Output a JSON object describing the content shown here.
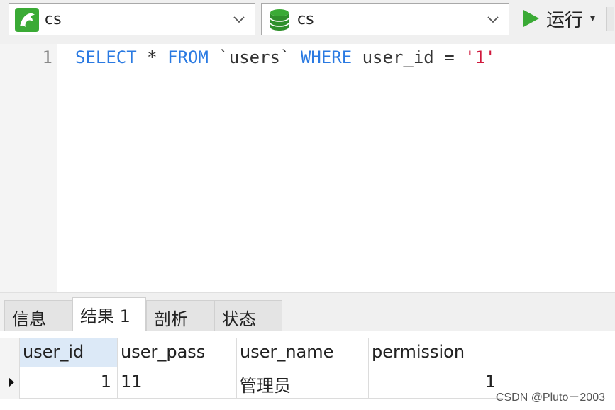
{
  "toolbar": {
    "connection": {
      "label": "cs",
      "icon": "mysql-dolphin-icon"
    },
    "database": {
      "label": "cs",
      "icon": "database-icon"
    },
    "run_label": "运行",
    "run_caret": "▾"
  },
  "editor": {
    "line_number": "1",
    "tokens": {
      "select": "SELECT",
      "star": " * ",
      "from": "FROM",
      "table": " `users` ",
      "where": "WHERE",
      "cond": " user_id = ",
      "value": "'1'"
    }
  },
  "tabs": [
    {
      "label": "信息"
    },
    {
      "label": "结果 1"
    },
    {
      "label": "剖析"
    },
    {
      "label": "状态"
    }
  ],
  "active_tab": "结果 1",
  "result": {
    "columns": [
      "user_id",
      "user_pass",
      "user_name",
      "permission"
    ],
    "rows": [
      [
        "1",
        "11",
        "管理员",
        "1"
      ]
    ]
  },
  "watermark": "CSDN @Pluto－2003",
  "colors": {
    "keyword": "#2a7ae2",
    "string": "#d0183c",
    "run_green": "#3aaa35",
    "selected_header": "#dce9f7"
  }
}
